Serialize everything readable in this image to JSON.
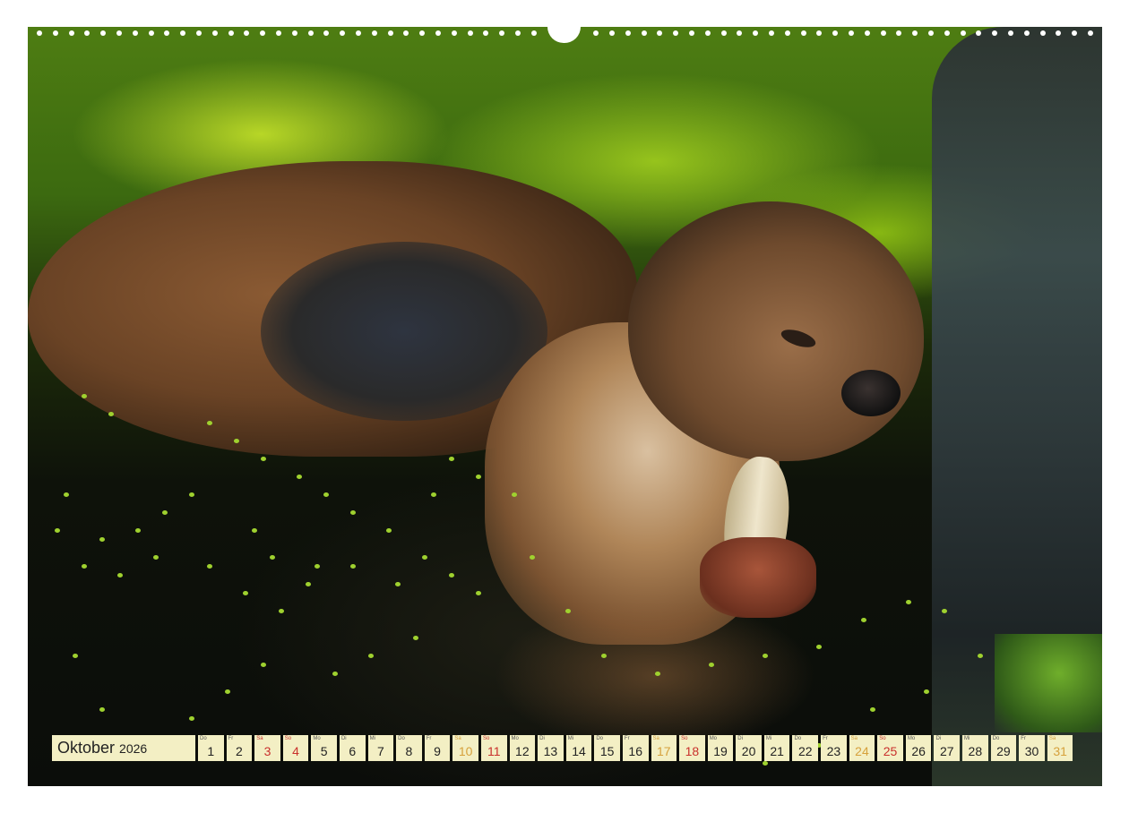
{
  "calendar": {
    "month": "Oktober",
    "year": "2026",
    "days": [
      {
        "dow": "Do",
        "num": "1",
        "kind": "weekday"
      },
      {
        "dow": "Fr",
        "num": "2",
        "kind": "weekday"
      },
      {
        "dow": "Sa",
        "num": "3",
        "kind": "sunday"
      },
      {
        "dow": "So",
        "num": "4",
        "kind": "sunday"
      },
      {
        "dow": "Mo",
        "num": "5",
        "kind": "weekday"
      },
      {
        "dow": "Di",
        "num": "6",
        "kind": "weekday"
      },
      {
        "dow": "Mi",
        "num": "7",
        "kind": "weekday"
      },
      {
        "dow": "Do",
        "num": "8",
        "kind": "weekday"
      },
      {
        "dow": "Fr",
        "num": "9",
        "kind": "weekday"
      },
      {
        "dow": "Sa",
        "num": "10",
        "kind": "weekend"
      },
      {
        "dow": "So",
        "num": "11",
        "kind": "sunday"
      },
      {
        "dow": "Mo",
        "num": "12",
        "kind": "weekday"
      },
      {
        "dow": "Di",
        "num": "13",
        "kind": "weekday"
      },
      {
        "dow": "Mi",
        "num": "14",
        "kind": "weekday"
      },
      {
        "dow": "Do",
        "num": "15",
        "kind": "weekday"
      },
      {
        "dow": "Fr",
        "num": "16",
        "kind": "weekday"
      },
      {
        "dow": "Sa",
        "num": "17",
        "kind": "weekend"
      },
      {
        "dow": "So",
        "num": "18",
        "kind": "sunday"
      },
      {
        "dow": "Mo",
        "num": "19",
        "kind": "weekday"
      },
      {
        "dow": "Di",
        "num": "20",
        "kind": "weekday"
      },
      {
        "dow": "Mi",
        "num": "21",
        "kind": "weekday"
      },
      {
        "dow": "Do",
        "num": "22",
        "kind": "weekday"
      },
      {
        "dow": "Fr",
        "num": "23",
        "kind": "weekday"
      },
      {
        "dow": "Sa",
        "num": "24",
        "kind": "weekend"
      },
      {
        "dow": "So",
        "num": "25",
        "kind": "sunday"
      },
      {
        "dow": "Mo",
        "num": "26",
        "kind": "weekday"
      },
      {
        "dow": "Di",
        "num": "27",
        "kind": "weekday"
      },
      {
        "dow": "Mi",
        "num": "28",
        "kind": "weekday"
      },
      {
        "dow": "Do",
        "num": "29",
        "kind": "weekday"
      },
      {
        "dow": "Fr",
        "num": "30",
        "kind": "weekday"
      },
      {
        "dow": "Sa",
        "num": "31",
        "kind": "weekend"
      }
    ]
  },
  "colors": {
    "strip_background": "#f3efc4",
    "saturday_color": "#d6a13c",
    "sunday_color": "#c9302c"
  }
}
